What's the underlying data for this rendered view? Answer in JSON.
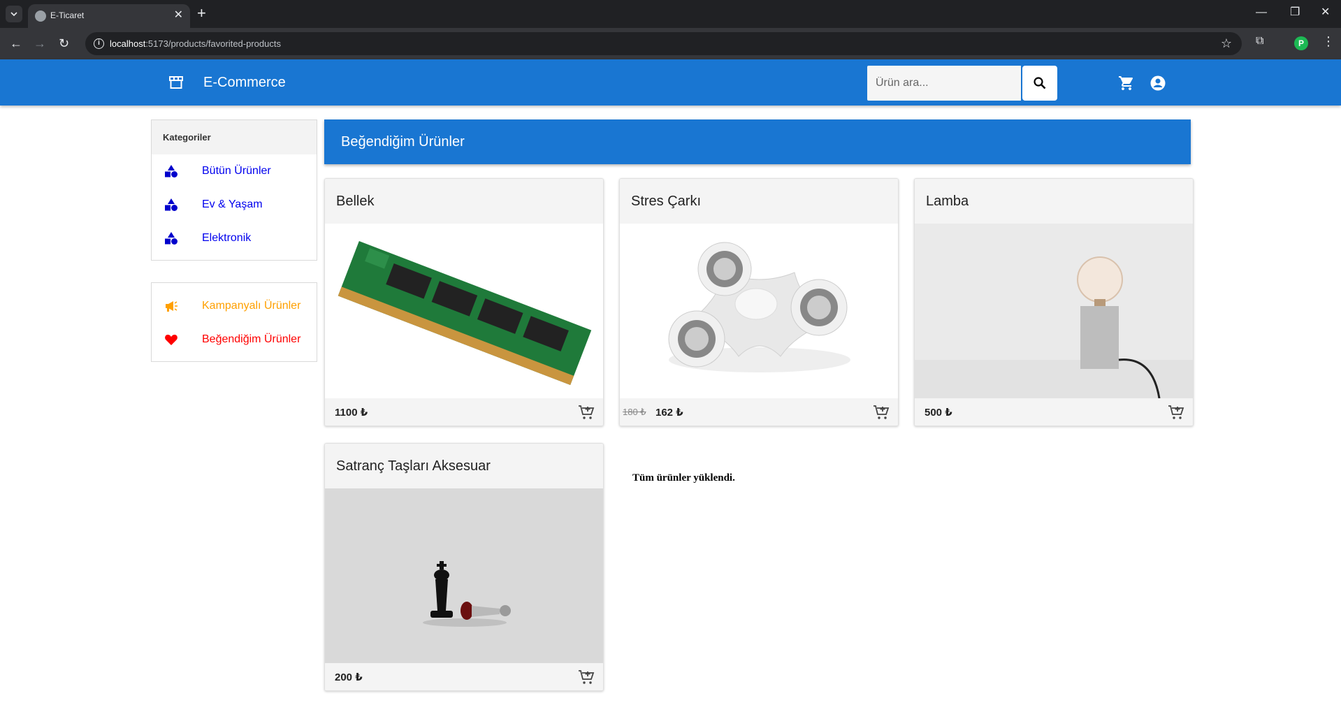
{
  "browser": {
    "tab_title": "E-Ticaret",
    "url_host": "localhost",
    "url_path": ":5173/products/favorited-products",
    "profile_initial": "P"
  },
  "appbar": {
    "brand": "E-Commerce",
    "search_placeholder": "Ürün ara...",
    "color": "#1976d2"
  },
  "sidebar": {
    "header": "Kategoriler",
    "categories": [
      {
        "label": "Bütün Ürünler",
        "icon": "category-shapes-icon"
      },
      {
        "label": "Ev & Yaşam",
        "icon": "category-shapes-icon"
      },
      {
        "label": "Elektronik",
        "icon": "category-shapes-icon"
      }
    ],
    "special": [
      {
        "label": "Kampanyalı Ürünler",
        "icon": "megaphone-icon",
        "color": "#ffa000"
      },
      {
        "label": "Beğendiğim Ürünler",
        "icon": "heart-icon",
        "color": "#ff0000"
      }
    ]
  },
  "main": {
    "title": "Beğendiğim Ürünler",
    "products": [
      {
        "name": "Bellek",
        "price": "1100 ₺",
        "image": "ram-module"
      },
      {
        "name": "Stres Çarkı",
        "old_price": "180 ₺",
        "price": "162 ₺",
        "image": "fidget-spinner"
      },
      {
        "name": "Lamba",
        "price": "500 ₺",
        "image": "lamp"
      },
      {
        "name": "Satranç Taşları Aksesuar",
        "price": "200 ₺",
        "image": "chess-pieces"
      }
    ],
    "status": "Tüm ürünler yüklendi."
  }
}
